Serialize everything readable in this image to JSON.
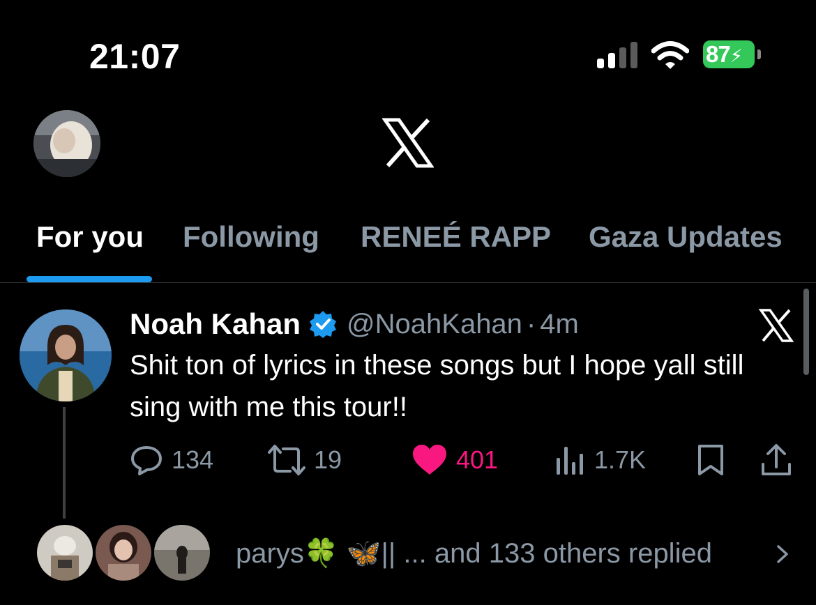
{
  "status_bar": {
    "time": "21:07",
    "battery": "87"
  },
  "tabs": [
    {
      "label": "For you",
      "active": true
    },
    {
      "label": "Following",
      "active": false
    },
    {
      "label": "RENEÉ RAPP",
      "active": false
    },
    {
      "label": "Gaza Updates",
      "active": false
    }
  ],
  "tweet": {
    "author": "Noah Kahan",
    "handle": "@NoahKahan",
    "separator": "·",
    "time": "4m",
    "text": "Shit ton of lyrics in these songs but I hope yall still sing with me this tour!!",
    "replies": "134",
    "reposts": "19",
    "likes": "401",
    "views": "1.7K"
  },
  "reply_preview": {
    "text": "parys🍀 🦋|| ... and 133 others replied"
  },
  "colors": {
    "accent": "#1d9bf0",
    "like": "#f91880",
    "battery": "#34c759",
    "muted": "#8b98a5"
  },
  "icons": [
    "signal-icon",
    "wifi-icon",
    "x-logo-icon",
    "verified-icon",
    "reply-icon",
    "repost-icon",
    "heart-icon",
    "views-icon",
    "bookmark-icon",
    "share-icon",
    "chevron-right-icon"
  ]
}
